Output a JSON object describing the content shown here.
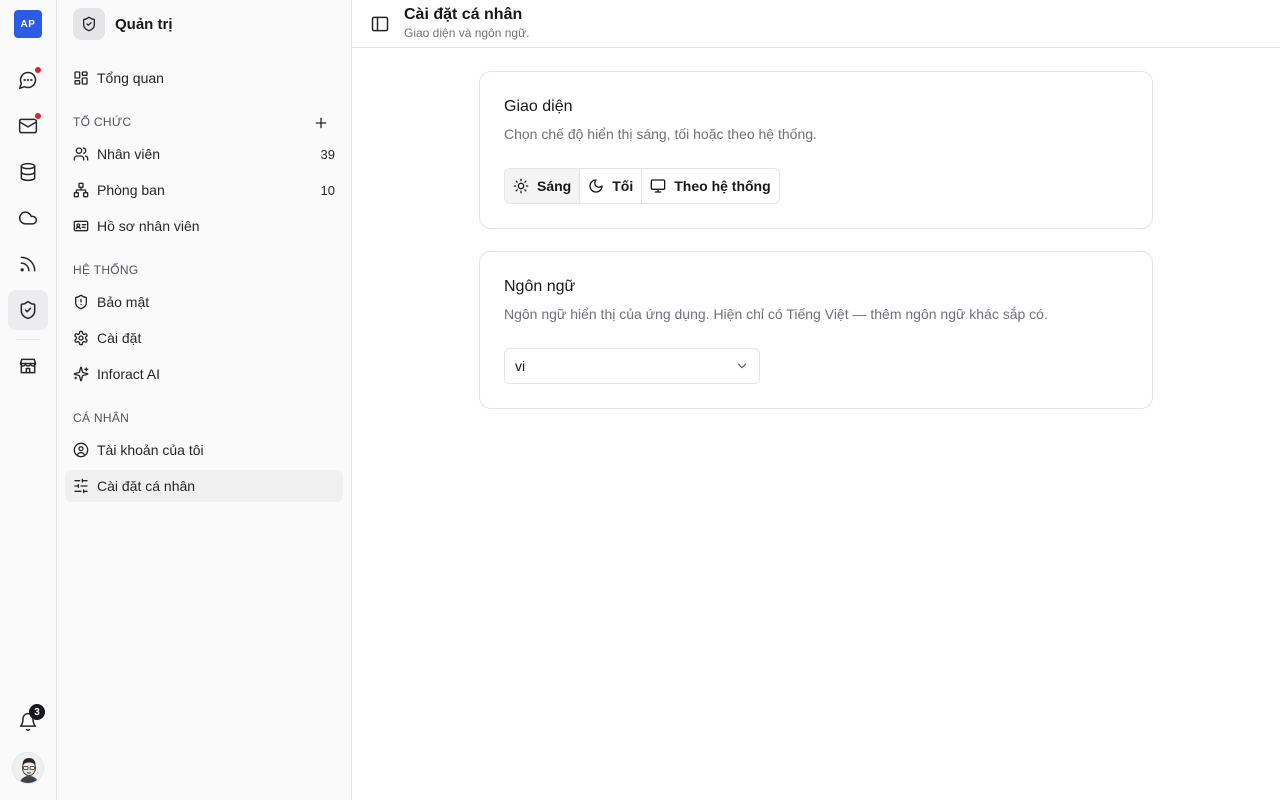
{
  "rail": {
    "logo_text": "AP",
    "items": [
      {
        "icon": "chat-icon",
        "has_dot": true
      },
      {
        "icon": "mail-icon",
        "has_dot": true
      },
      {
        "icon": "database-icon",
        "has_dot": false
      },
      {
        "icon": "cloud-icon",
        "has_dot": false
      },
      {
        "icon": "rss-icon",
        "has_dot": false
      },
      {
        "icon": "shield-check-icon",
        "active": true
      },
      {
        "icon": "store-icon",
        "has_dot": false
      }
    ],
    "notifications_count": "3"
  },
  "sidebar": {
    "title": "Quản trị",
    "overview": "Tổng quan",
    "sections": {
      "org": "TỔ CHỨC",
      "system": "HỆ THỐNG",
      "personal": "CÁ NHÂN"
    },
    "items": {
      "employees": {
        "label": "Nhân viên",
        "count": "39"
      },
      "departments": {
        "label": "Phòng ban",
        "count": "10"
      },
      "profiles": {
        "label": "Hồ sơ nhân viên"
      },
      "security": {
        "label": "Bảo mật"
      },
      "settings": {
        "label": "Cài đặt"
      },
      "ai": {
        "label": "Inforact AI"
      },
      "account": {
        "label": "Tài khoản của tôi"
      },
      "personal_settings": {
        "label": "Cài đặt cá nhân",
        "active": true
      }
    }
  },
  "header": {
    "title": "Cài đặt cá nhân",
    "subtitle": "Giao diện và ngôn ngữ."
  },
  "appearance": {
    "title": "Giao diện",
    "description": "Chọn chế độ hiển thị sáng, tối hoặc theo hệ thống.",
    "options": {
      "light": "Sáng",
      "dark": "Tối",
      "system": "Theo hệ thống"
    },
    "selected": "light"
  },
  "language": {
    "title": "Ngôn ngữ",
    "description": "Ngôn ngữ hiển thị của ứng dụng. Hiện chỉ có Tiếng Việt — thêm ngôn ngữ khác sắp có.",
    "value": "vi"
  },
  "colors": {
    "accent": "#2b5ce6",
    "notification_dot": "#e11d2e"
  }
}
